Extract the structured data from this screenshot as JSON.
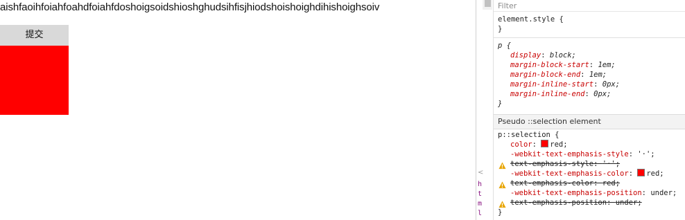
{
  "page": {
    "paragraph_text": "aishfaoihfoiahfoahdfoiahfdoshoigsoidshioshghudsihfisjhiodshoishoighdihishoighsoiv",
    "submit_button_label": "提交",
    "box_color": "#ff0000"
  },
  "devtools": {
    "gutter_letters": [
      "h",
      "t",
      "m",
      "l"
    ],
    "filter": {
      "placeholder": "Filter"
    },
    "element_style": {
      "selector": "element.style {",
      "close": "}"
    },
    "ua_rule": {
      "selector": "p {",
      "declarations": [
        {
          "prop": "display",
          "value": "block;"
        },
        {
          "prop": "margin-block-start",
          "value": "1em;"
        },
        {
          "prop": "margin-block-end",
          "value": "1em;"
        },
        {
          "prop": "margin-inline-start",
          "value": "0px;"
        },
        {
          "prop": "margin-inline-end",
          "value": "0px;"
        }
      ],
      "close": "}"
    },
    "pseudo_header": "Pseudo ::selection element",
    "selection_rule": {
      "selector": "p::selection {",
      "declarations": [
        {
          "prop": "color",
          "value": "red;",
          "swatch": "#ff0000",
          "struck": false,
          "warning": false
        },
        {
          "prop": "-webkit-text-emphasis-style",
          "value": "'·';",
          "struck": false,
          "warning": false
        },
        {
          "prop": "text-emphasis-style",
          "value": "'·';",
          "struck": true,
          "warning": true
        },
        {
          "prop": "-webkit-text-emphasis-color",
          "value": "red;",
          "swatch": "#ff0000",
          "struck": false,
          "warning": false
        },
        {
          "prop": "text-emphasis-color",
          "value": "red;",
          "struck": true,
          "warning": true
        },
        {
          "prop": "-webkit-text-emphasis-position",
          "value": "under;",
          "struck": false,
          "warning": false
        },
        {
          "prop": "text-emphasis-position",
          "value": "under;",
          "struck": true,
          "warning": true
        }
      ],
      "close": "}"
    }
  },
  "icons": {
    "warning": "warning-triangle-icon",
    "collapse": "chevron-left-icon"
  },
  "colors": {
    "property": "#c80000",
    "warning": "#e8a400",
    "swatch": "#ff0000"
  }
}
